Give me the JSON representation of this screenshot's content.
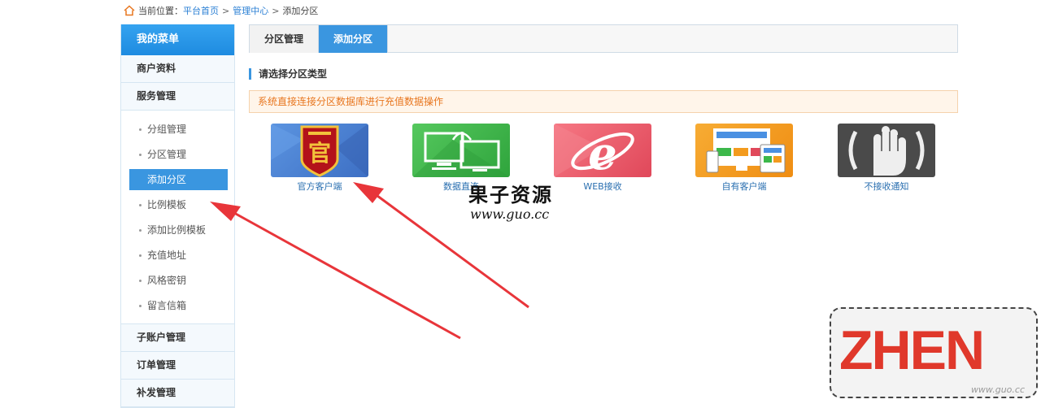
{
  "breadcrumb": {
    "prefix": "当前位置：",
    "home": "平台首页",
    "sep1": ">",
    "mid": "管理中心",
    "sep2": ">",
    "current": "添加分区"
  },
  "sidebar": {
    "title": "我的菜单",
    "groups": [
      {
        "label": "商户资料"
      },
      {
        "label": "服务管理"
      }
    ],
    "items": [
      {
        "label": "分组管理"
      },
      {
        "label": "分区管理"
      },
      {
        "label": "添加分区",
        "active": true
      },
      {
        "label": "比例模板"
      },
      {
        "label": "添加比例模板"
      },
      {
        "label": "充值地址"
      },
      {
        "label": "风格密钥"
      },
      {
        "label": "留言信箱"
      }
    ],
    "groups_after": [
      {
        "label": "子账户管理"
      },
      {
        "label": "订单管理"
      },
      {
        "label": "补发管理"
      }
    ]
  },
  "tabs": [
    {
      "label": "分区管理",
      "active": false
    },
    {
      "label": "添加分区",
      "active": true
    }
  ],
  "section_title": "请选择分区类型",
  "notice": "系统直接连接分区数据库进行充值数据操作",
  "cards": [
    {
      "label": "官方客户端",
      "icon": "official-badge-icon",
      "color": "#4a7fd0"
    },
    {
      "label": "数据直连",
      "icon": "monitor-connect-icon",
      "color": "#3cb84a"
    },
    {
      "label": "WEB接收",
      "icon": "web-browser-icon",
      "color": "#ef5a6a"
    },
    {
      "label": "自有客户端",
      "icon": "devices-icon",
      "color": "#f39b1e"
    },
    {
      "label": "不接收通知",
      "icon": "stop-hand-icon",
      "color": "#444444"
    }
  ],
  "watermark": {
    "cn": "果子资源",
    "en": "www.guo.cc"
  },
  "logo": {
    "text": "ZHEN",
    "url": "www.guo.cc"
  },
  "colors": {
    "accent": "#3a96e0",
    "notice_text": "#e8761f",
    "arrow": "#e8353a"
  }
}
